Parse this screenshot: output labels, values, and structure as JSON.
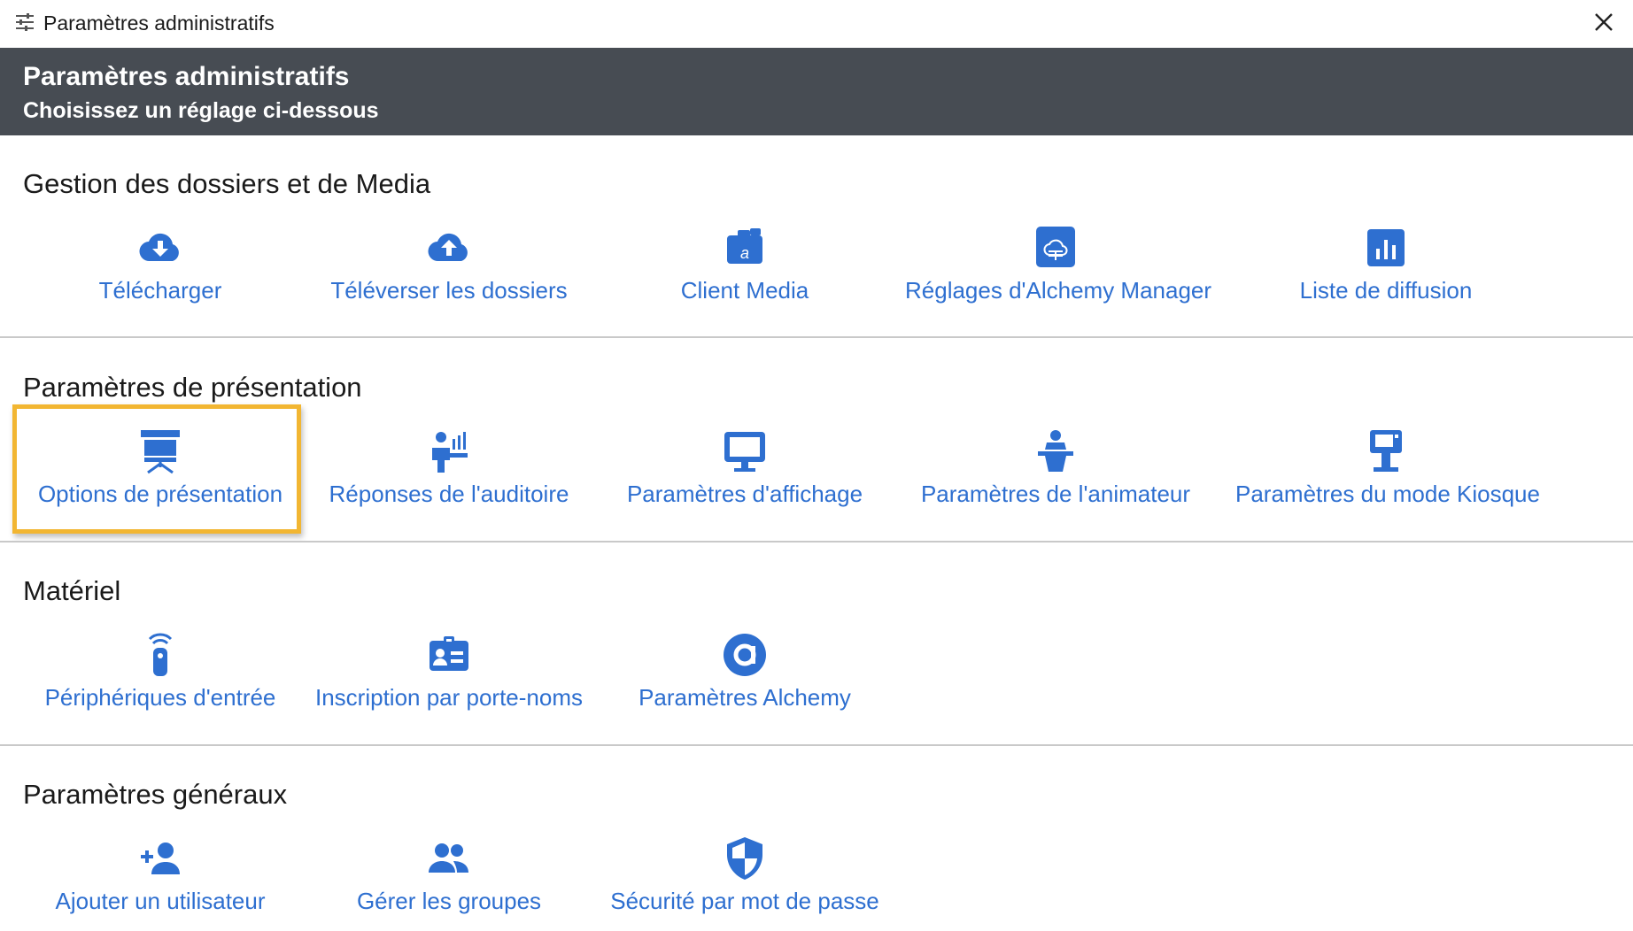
{
  "window": {
    "title": "Paramètres administratifs",
    "app_icon": "sliders-icon",
    "close_icon": "close-icon"
  },
  "header": {
    "title": "Paramètres administratifs",
    "subtitle": "Choisissez un réglage ci-dessous"
  },
  "colors": {
    "header_bg": "#474c53",
    "link": "#2e6fd0",
    "icon": "#2e6fd0",
    "highlight": "#f2b632",
    "divider": "#c9c9c9"
  },
  "sections": [
    {
      "title": "Gestion des dossiers et de Media",
      "items": [
        {
          "label": "Télécharger",
          "icon": "cloud-download-icon"
        },
        {
          "label": "Téléverser les dossiers",
          "icon": "cloud-upload-icon"
        },
        {
          "label": "Client Media",
          "icon": "media-client-icon"
        },
        {
          "label": "Réglages d'Alchemy Manager",
          "icon": "cloud-settings-icon"
        },
        {
          "label": "Liste de diffusion",
          "icon": "bar-chart-icon"
        }
      ]
    },
    {
      "title": "Paramètres de présentation",
      "items": [
        {
          "label": "Options de présentation",
          "icon": "presentation-easel-icon",
          "highlighted": true
        },
        {
          "label": "Réponses de l'auditoire",
          "icon": "audience-responses-icon"
        },
        {
          "label": "Paramètres d'affichage",
          "icon": "monitor-icon"
        },
        {
          "label": "Paramètres de l'animateur",
          "icon": "presenter-podium-icon"
        },
        {
          "label": "Paramètres du mode Kiosque",
          "icon": "kiosk-icon"
        }
      ]
    },
    {
      "title": "Matériel",
      "items": [
        {
          "label": "Périphériques d'entrée",
          "icon": "wireless-remote-icon"
        },
        {
          "label": "Inscription par porte-noms",
          "icon": "badge-icon"
        },
        {
          "label": "Paramètres Alchemy",
          "icon": "alchemy-logo-icon"
        }
      ]
    },
    {
      "title": "Paramètres généraux",
      "items": [
        {
          "label": "Ajouter un utilisateur",
          "icon": "add-user-icon"
        },
        {
          "label": "Gérer les groupes",
          "icon": "group-icon"
        },
        {
          "label": "Sécurité par mot de passe",
          "icon": "shield-icon"
        }
      ]
    }
  ]
}
